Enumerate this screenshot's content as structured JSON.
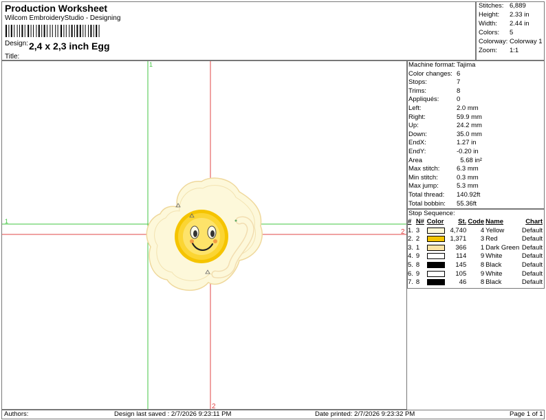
{
  "header": {
    "title": "Production Worksheet",
    "subtitle": "Wilcom EmbroideryStudio - Designing",
    "design_label": "Design:",
    "design_name": "2,4 x 2,3 inch Egg",
    "title_label": "Title:"
  },
  "summary": [
    {
      "k": "Stitches:",
      "v": "6,889"
    },
    {
      "k": "Height:",
      "v": "2.33 in"
    },
    {
      "k": "Width:",
      "v": "2.44 in"
    },
    {
      "k": "Colors:",
      "v": "5"
    },
    {
      "k": "Colorway:",
      "v": "Colorway 1"
    },
    {
      "k": "Zoom:",
      "v": "1:1"
    }
  ],
  "machine": [
    {
      "k": "Machine format:",
      "v": "Tajima"
    },
    {
      "k": "Color changes:",
      "v": "6"
    },
    {
      "k": "Stops:",
      "v": "7"
    },
    {
      "k": "Trims:",
      "v": "8"
    },
    {
      "k": "Appliqués:",
      "v": "0"
    },
    {
      "k": "Left:",
      "v": "2.0 mm"
    },
    {
      "k": "Right:",
      "v": "59.9 mm"
    },
    {
      "k": "Up:",
      "v": "24.2 mm"
    },
    {
      "k": "Down:",
      "v": "35.0 mm"
    },
    {
      "k": "EndX:",
      "v": "1.27 in"
    },
    {
      "k": "EndY:",
      "v": "-0.20 in"
    },
    {
      "k": "Area",
      "v": "  5.68 in²"
    },
    {
      "k": "Max stitch:",
      "v": "6.3 mm"
    },
    {
      "k": "Min stitch:",
      "v": "0.3 mm"
    },
    {
      "k": "Max jump:",
      "v": "5.3 mm"
    },
    {
      "k": "Total thread:",
      "v": "140.92ft"
    },
    {
      "k": "Total bobbin:",
      "v": "55.36ft"
    }
  ],
  "stop_sequence": {
    "title": "Stop Sequence:",
    "headers": {
      "num": "#",
      "n": "N#",
      "color": "Color",
      "st": "St.",
      "code": "Code",
      "name": "Name",
      "chart": "Chart"
    },
    "rows": [
      {
        "num": "1.",
        "n": "3",
        "color": "#fdf8d8",
        "st": "4,740",
        "code": "4",
        "name": "Yellow",
        "chart": "Default"
      },
      {
        "num": "2.",
        "n": "2",
        "color": "#f5c400",
        "st": "1,371",
        "code": "3",
        "name": "Red",
        "chart": "Default"
      },
      {
        "num": "3.",
        "n": "1",
        "color": "#fbe3a4",
        "st": "366",
        "code": "1",
        "name": "Dark Green",
        "chart": "Default"
      },
      {
        "num": "4.",
        "n": "9",
        "color": "#ffffff",
        "st": "114",
        "code": "9",
        "name": "White",
        "chart": "Default"
      },
      {
        "num": "5.",
        "n": "8",
        "color": "#000000",
        "st": "145",
        "code": "8",
        "name": "Black",
        "chart": "Default"
      },
      {
        "num": "6.",
        "n": "9",
        "color": "#ffffff",
        "st": "105",
        "code": "9",
        "name": "White",
        "chart": "Default"
      },
      {
        "num": "7.",
        "n": "8",
        "color": "#000000",
        "st": "46",
        "code": "8",
        "name": "Black",
        "chart": "Default"
      }
    ]
  },
  "canvas": {
    "guide_v_label": "1",
    "guide_h_label": "1",
    "center_h_label": "2",
    "center_v_label": "2",
    "guide_green": "#41c441",
    "guide_red": "#e04444"
  },
  "footer": {
    "authors": "Authors:",
    "saved": "Design last saved : 2/7/2026 9:23:11 PM",
    "printed": "Date printed: 2/7/2026 9:23:32 PM",
    "page": "Page 1 of 1"
  }
}
